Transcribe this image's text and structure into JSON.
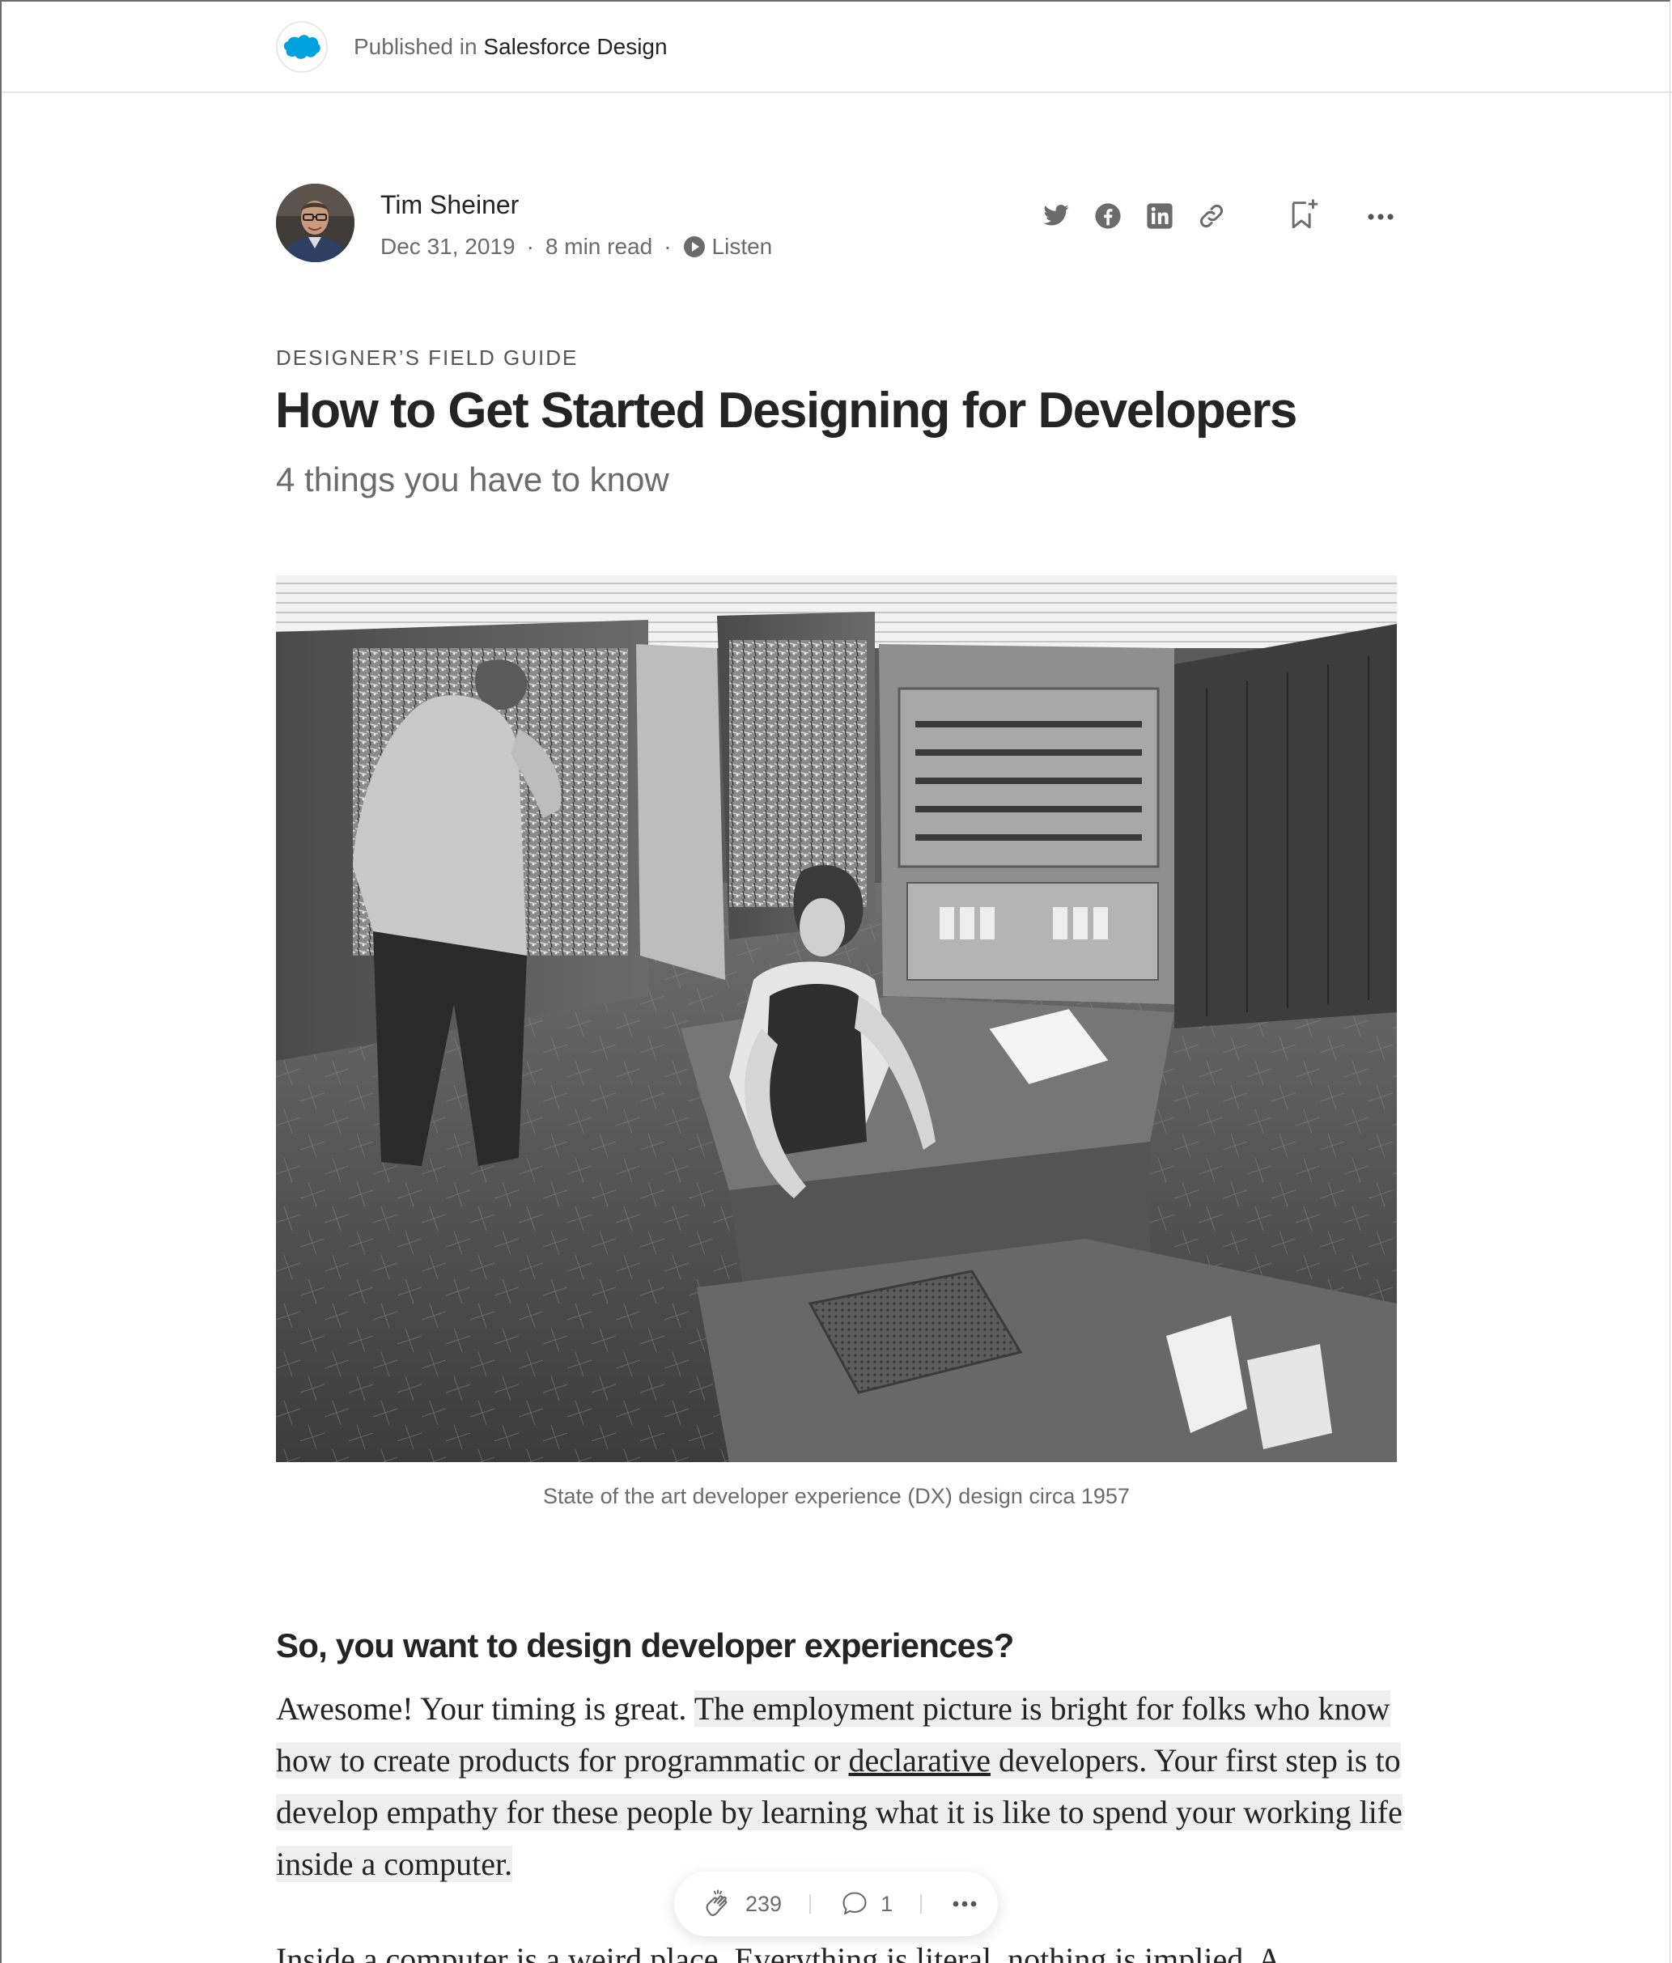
{
  "publication": {
    "prefix": "Published in",
    "name": "Salesforce Design"
  },
  "author": {
    "name": "Tim Sheiner",
    "date": "Dec 31, 2019",
    "read_time": "8 min read",
    "listen_label": "Listen"
  },
  "article": {
    "kicker": "DESIGNER’S FIELD GUIDE",
    "title": "How to Get Started Designing for Developers",
    "subtitle": "4 things you have to know",
    "image_caption": "State of the art developer experience (DX) design circa 1957",
    "section_heading": "So, you want to design developer experiences?",
    "para1_intro": "Awesome! Your timing is great. ",
    "para1_hl_a": "The employment picture is bright for folks who know how to create products for programmatic or ",
    "para1_link": "declarative",
    "para1_hl_b": " developers. Your first step is to develop empathy for these people by learning what it is like to spend your working life inside a computer.",
    "para2": "Inside a computer is a weird place. Everything is literal, nothing is implied. A"
  },
  "engagement": {
    "claps": "239",
    "responses": "1"
  },
  "icons": {
    "twitter": "twitter-icon",
    "facebook": "facebook-icon",
    "linkedin": "linkedin-icon",
    "link": "link-icon",
    "bookmark": "bookmark-add-icon",
    "more": "more-icon",
    "clap": "clap-icon",
    "response": "speech-bubble-icon",
    "play": "play-icon"
  },
  "colors": {
    "brand": "#00a1e0",
    "text": "#242424",
    "muted": "#6b6b6b",
    "highlight": "#efefef"
  }
}
